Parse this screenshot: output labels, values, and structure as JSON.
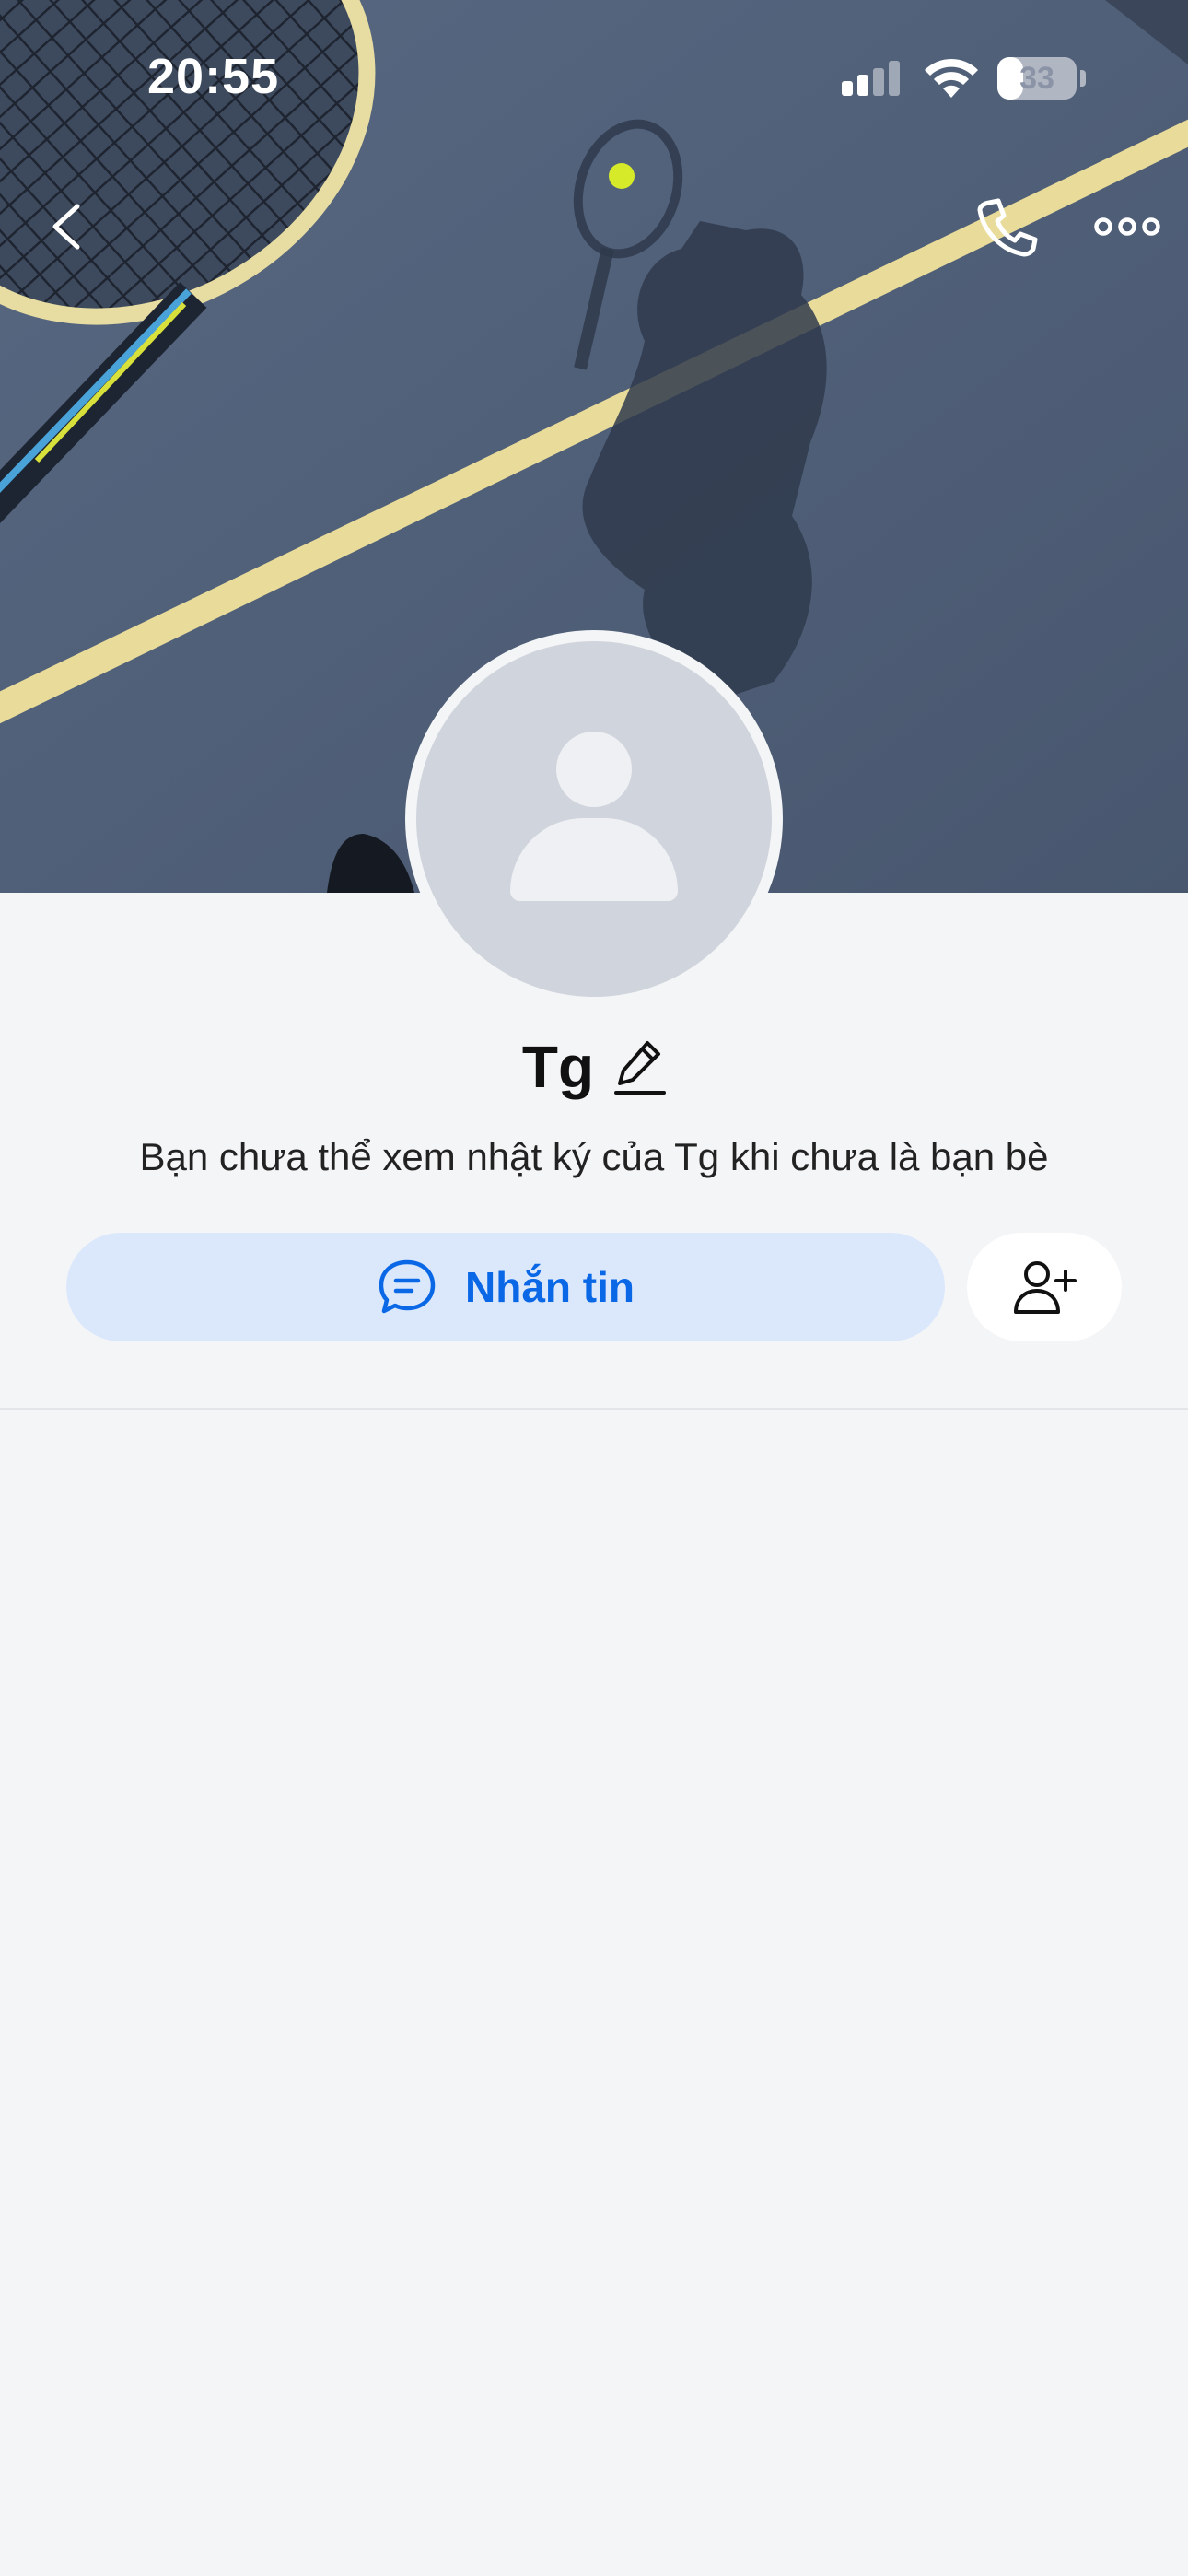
{
  "status_bar": {
    "time": "20:55",
    "battery_level": "33",
    "battery_fraction": 0.33,
    "signal_icon": "cellular-signal-icon",
    "wifi_icon": "wifi-icon"
  },
  "nav": {
    "back_icon": "chevron-left-icon",
    "call_icon": "phone-icon",
    "more_icon": "more-horizontal-icon"
  },
  "profile": {
    "name": "Tg",
    "edit_icon": "pencil-icon",
    "avatar_icon": "default-avatar-icon",
    "notice": "Bạn chưa thể xem nhật ký của Tg khi chưa là bạn bè"
  },
  "actions": {
    "message_label": "Nhắn tin",
    "message_icon": "chat-bubble-icon",
    "add_friend_icon": "add-user-icon"
  },
  "colors": {
    "accent": "#0a68e6",
    "message_button_bg": "#dbe8fc",
    "page_bg": "#f4f5f7",
    "cover_court": "#4f5f78",
    "court_line": "#e9dc9a"
  }
}
